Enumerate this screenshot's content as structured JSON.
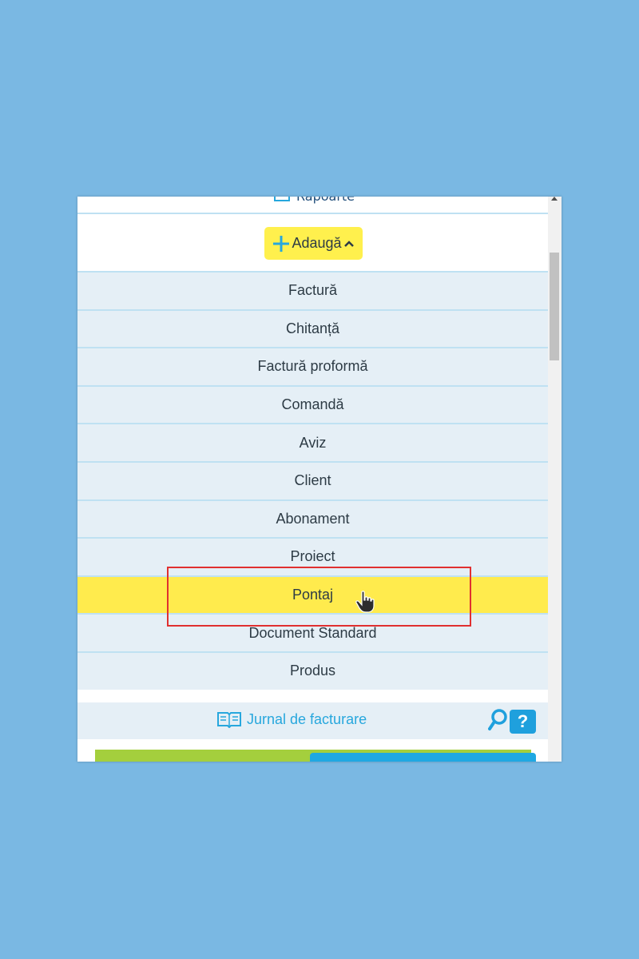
{
  "header": {
    "rapoarte_label": "Rapoarte"
  },
  "add_menu": {
    "button_label": "Adaugă",
    "items": [
      {
        "label": "Factură"
      },
      {
        "label": "Chitanță"
      },
      {
        "label": "Factură proformă"
      },
      {
        "label": "Comandă"
      },
      {
        "label": "Aviz"
      },
      {
        "label": "Client"
      },
      {
        "label": "Abonament"
      },
      {
        "label": "Proiect"
      },
      {
        "label": "Pontaj",
        "highlighted": true
      },
      {
        "label": "Document Standard"
      },
      {
        "label": "Produs"
      }
    ]
  },
  "journal": {
    "label": "Jurnal de facturare",
    "help_label": "?"
  },
  "colors": {
    "background": "#7ab8e3",
    "accent_yellow": "#ffeb4d",
    "accent_blue": "#1fa0dd",
    "highlight_outline": "#e03030"
  },
  "icons": {
    "rapoarte": "report-icon",
    "add": "plus-icon",
    "chevron": "chevron-up-icon",
    "cursor": "hand-cursor-icon",
    "journal": "book-icon",
    "search": "search-icon"
  }
}
